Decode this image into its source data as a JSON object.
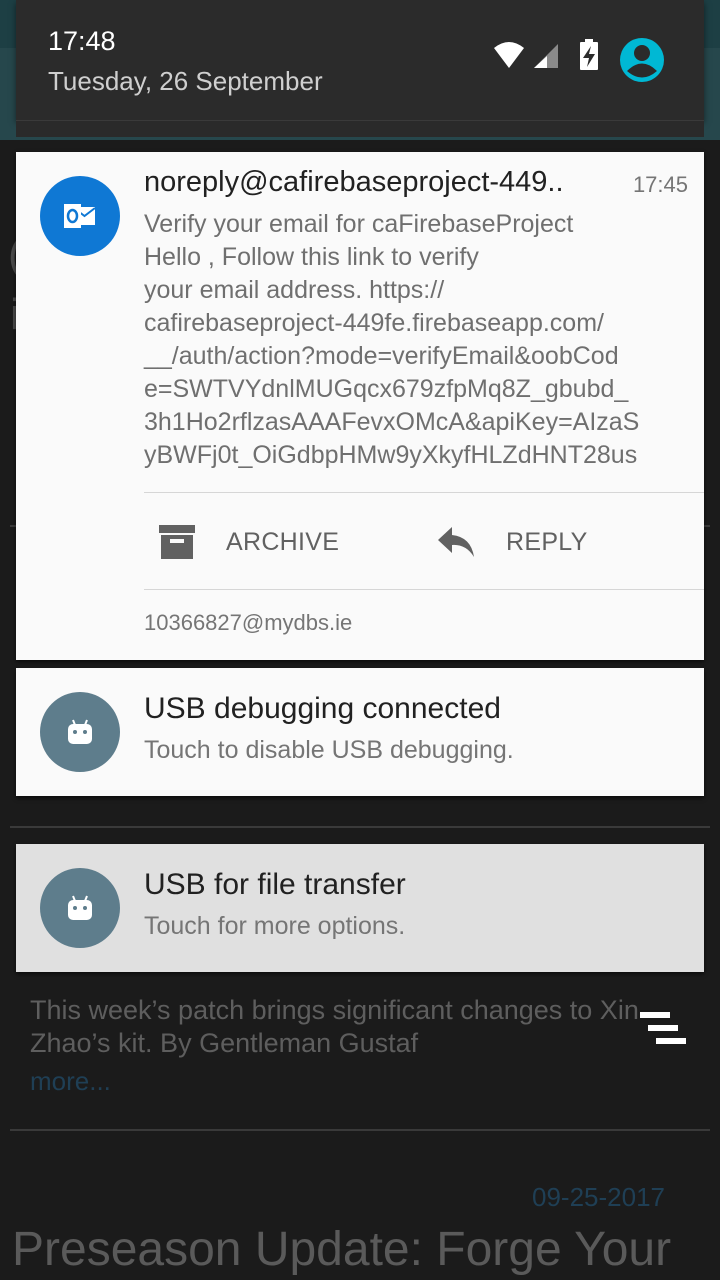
{
  "status_bar": {
    "time": "17:48",
    "date": "Tuesday, 26 September",
    "icons": [
      "wifi-icon",
      "cell-signal-icon",
      "battery-charging-icon",
      "account-icon"
    ]
  },
  "notifications": [
    {
      "app_icon": "outlook-icon",
      "title": "noreply@cafirebaseproject-449..",
      "time": "17:45",
      "body_lines": [
        "Verify your email for caFirebaseProject",
        "Hello , Follow this link to verify",
        "your email address. https://",
        "cafirebaseproject-449fe.firebaseapp.com/",
        "__/auth/action?mode=verifyEmail&oobCod",
        "e=SWTVYdnlMUGqcx679zfpMq8Z_gbubd_",
        "3h1Ho2rflzasAAAFevxOMcA&apiKey=AIzaS",
        "yBWFj0t_OiGdbpHMw9yXkyfHLZdHNT28us"
      ],
      "actions": [
        {
          "icon": "archive-icon",
          "label": "ARCHIVE"
        },
        {
          "icon": "reply-icon",
          "label": "REPLY"
        }
      ],
      "account": "10366827@mydbs.ie"
    },
    {
      "app_icon": "android-icon",
      "title": "USB debugging connected",
      "subtitle": "Touch to disable USB debugging."
    },
    {
      "app_icon": "android-icon",
      "title": "USB for file transfer",
      "subtitle": "Touch for more options."
    }
  ],
  "background": {
    "article_text": [
      "This week’s patch brings significant changes to Xin",
      "Zhao’s kit. By Gentleman Gustaf"
    ],
    "more_link": "more...",
    "date": "09-25-2017",
    "next_title": "Preseason Update: Forge Your"
  },
  "colors": {
    "outlook_blue": "#0f78d4",
    "android_avatar": "#5e7d8c",
    "account_cyan": "#00b8d4"
  }
}
